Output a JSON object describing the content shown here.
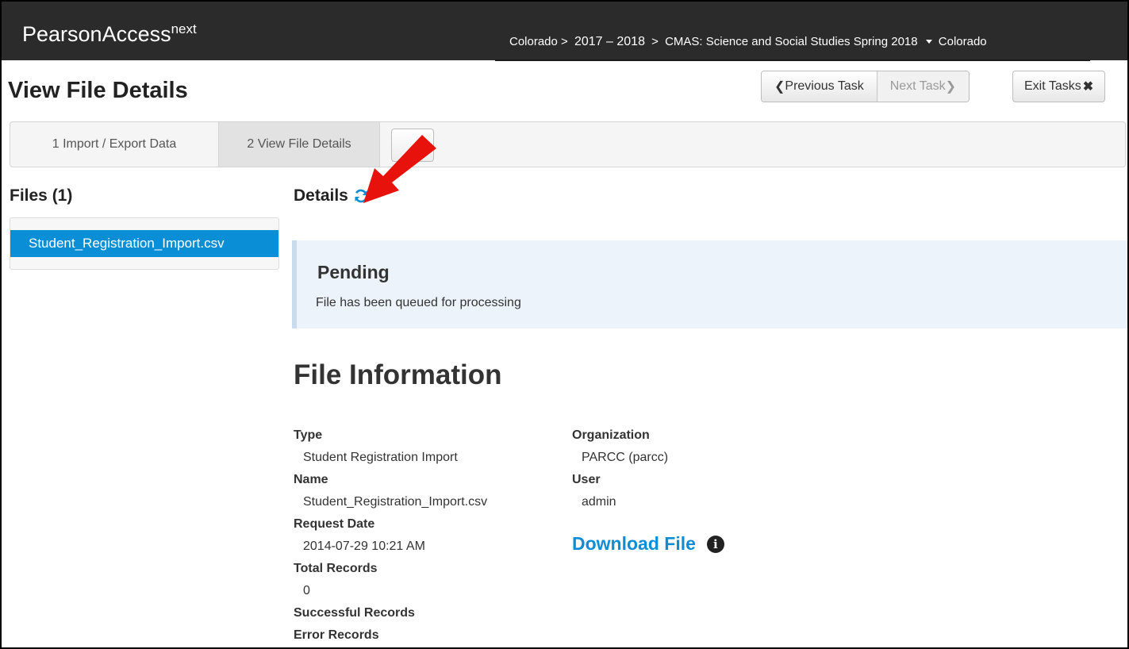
{
  "app": {
    "brand": "PearsonAccess",
    "brand_sup": "next"
  },
  "breadcrumb": {
    "state": "Colorado >",
    "year": "2017 – 2018",
    "sep": ">",
    "test": "CMAS: Science and Social Studies Spring 2018",
    "org": "Colorado"
  },
  "page": {
    "title": "View File Details"
  },
  "tasks": {
    "previous": "Previous Task",
    "next": "Next Task",
    "exit": "Exit Tasks"
  },
  "tabs": [
    {
      "label": "1 Import / Export Data",
      "active": false
    },
    {
      "label": "2 View File Details",
      "active": true
    }
  ],
  "files": {
    "heading": "Files (1)",
    "items": [
      {
        "name": "Student_Registration_Import.csv",
        "selected": true
      }
    ]
  },
  "details": {
    "heading": "Details",
    "status_title": "Pending",
    "status_text": "File has been queued for processing"
  },
  "file_info": {
    "heading": "File Information",
    "left": [
      {
        "label": "Type",
        "value": "Student Registration Import"
      },
      {
        "label": "Name",
        "value": "Student_Registration_Import.csv"
      },
      {
        "label": "Request Date",
        "value": "2014-07-29 10:21 AM"
      },
      {
        "label": "Total Records",
        "value": "0"
      },
      {
        "label": "Successful Records",
        "value": ""
      },
      {
        "label": "Error Records",
        "value": ""
      }
    ],
    "right": [
      {
        "label": "Organization",
        "value": "PARCC (parcc)"
      },
      {
        "label": "User",
        "value": "admin"
      }
    ],
    "download_label": "Download File"
  },
  "colors": {
    "topbar": "#2b2b2b",
    "accent": "#0a8ed6",
    "pending_bg": "#ecf3fa",
    "annotation_arrow": "#e8120c"
  }
}
